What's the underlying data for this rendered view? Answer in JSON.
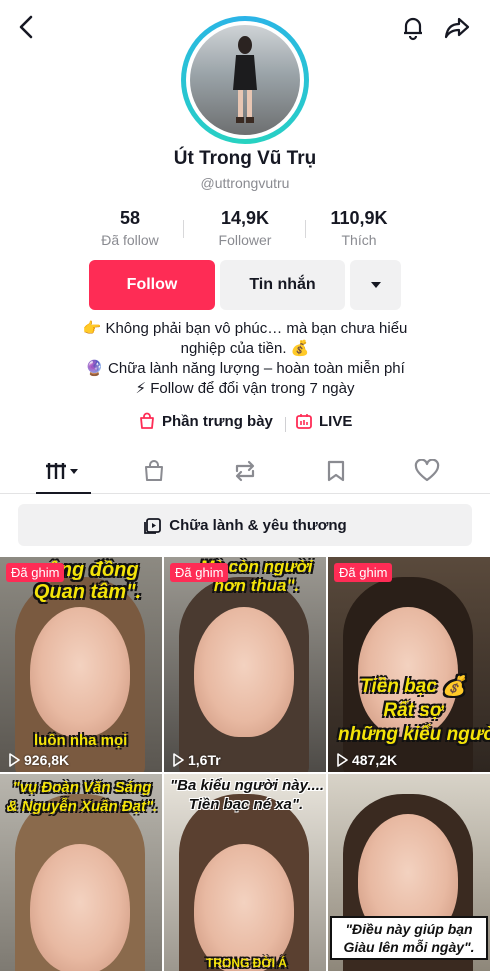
{
  "header": {
    "back_icon": "chevron-left-icon",
    "bell_icon": "bell-icon",
    "share_icon": "share-icon"
  },
  "profile": {
    "name": "Út Trong Vũ Trụ",
    "handle": "@uttrongvutru"
  },
  "stats": [
    {
      "value": "58",
      "label": "Đã follow"
    },
    {
      "value": "14,9K",
      "label": "Follower"
    },
    {
      "value": "110,9K",
      "label": "Thích"
    }
  ],
  "actions": {
    "follow": "Follow",
    "message": "Tin nhắn",
    "more_icon": "caret-down-icon"
  },
  "bio": [
    "👉 Không phải bạn vô phúc… mà bạn chưa hiểu",
    "nghiệp của tiền. 💰",
    "🔮 Chữa lành năng lượng – hoàn toàn miễn phí",
    "⚡ Follow để đổi vận trong 7 ngày"
  ],
  "links": {
    "showcase": "Phần trưng bày",
    "live": "LIVE"
  },
  "tabs": [
    "grid-icon",
    "shopping-bag-icon",
    "repost-icon",
    "bookmark-icon",
    "heart-icon"
  ],
  "playlist": {
    "label": "Chữa lành & yêu thương"
  },
  "videos": [
    {
      "badge": "Đã ghim",
      "views": "926,8K",
      "caption_top": "cộng đồng\nQuan tâm\".",
      "caption_bottom": "luôn nha mọi"
    },
    {
      "badge": "Đã ghim",
      "views": "1,6Tr",
      "caption_top": "Mà còn người\nhơn thua\".",
      "caption_bottom": ""
    },
    {
      "badge": "Đã ghim",
      "views": "487,2K",
      "caption_top": "",
      "caption_bottom": "Tiền bạc 💰\nRất sợ\nnhững kiểu người"
    },
    {
      "badge": "",
      "views": "",
      "caption_top": "\"vụ Đoàn Văn Sáng\n& Nguyễn Xuân Đạt\".",
      "caption_bottom": ""
    },
    {
      "badge": "",
      "views": "",
      "caption_top": "\"Ba kiểu người này....\nTiền bạc né xa\".",
      "caption_bottom": "TRONG ĐỜI Á"
    },
    {
      "badge": "",
      "views": "",
      "caption_top": "",
      "caption_bottom": "\"Điều này giúp bạn\nGiàu lên mỗi ngày\"."
    }
  ],
  "colors": {
    "accent": "#fe2c55",
    "text": "#161823",
    "muted": "#8a8b91",
    "button_bg": "#f1f1f2"
  }
}
